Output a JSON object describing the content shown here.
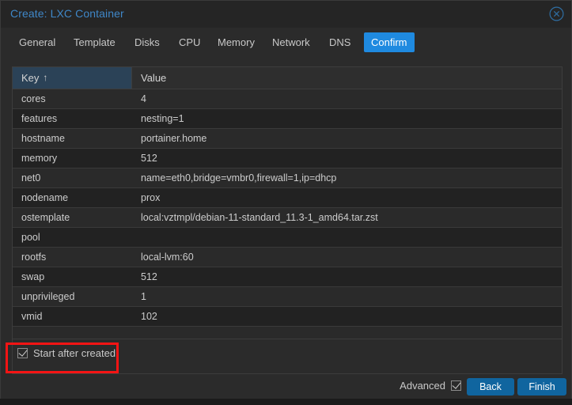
{
  "window": {
    "title": "Create: LXC Container",
    "close_icon": "close-circle-icon"
  },
  "tabs": [
    {
      "label": "General",
      "active": false
    },
    {
      "label": "Template",
      "active": false
    },
    {
      "label": "Disks",
      "active": false
    },
    {
      "label": "CPU",
      "active": false
    },
    {
      "label": "Memory",
      "active": false
    },
    {
      "label": "Network",
      "active": false
    },
    {
      "label": "DNS",
      "active": false
    },
    {
      "label": "Confirm",
      "active": true
    }
  ],
  "grid": {
    "columns": [
      {
        "label": "Key",
        "sorted": true,
        "sort_indicator": "↑"
      },
      {
        "label": "Value",
        "sorted": false,
        "sort_indicator": ""
      }
    ],
    "rows": [
      {
        "key": "cores",
        "value": "4"
      },
      {
        "key": "features",
        "value": "nesting=1"
      },
      {
        "key": "hostname",
        "value": "portainer.home"
      },
      {
        "key": "memory",
        "value": "512"
      },
      {
        "key": "net0",
        "value": "name=eth0,bridge=vmbr0,firewall=1,ip=dhcp"
      },
      {
        "key": "nodename",
        "value": "prox"
      },
      {
        "key": "ostemplate",
        "value": "local:vztmpl/debian-11-standard_11.3-1_amd64.tar.zst"
      },
      {
        "key": "pool",
        "value": ""
      },
      {
        "key": "rootfs",
        "value": "local-lvm:60"
      },
      {
        "key": "swap",
        "value": "512"
      },
      {
        "key": "unprivileged",
        "value": "1"
      },
      {
        "key": "vmid",
        "value": "102"
      },
      {
        "key": "",
        "value": ""
      }
    ]
  },
  "start_after_created": {
    "label": "Start after created",
    "checked": true,
    "highlighted": true,
    "highlight_color": "#f61414"
  },
  "footer": {
    "advanced_label": "Advanced",
    "advanced_checked": true,
    "back_label": "Back",
    "finish_label": "Finish"
  },
  "colors": {
    "accent": "#1f8ae0",
    "button": "#10659f",
    "title": "#3f87c8",
    "sorted_header": "#2b4257",
    "window_bg": "#2b2b2b",
    "grid_bg": "#232323"
  }
}
